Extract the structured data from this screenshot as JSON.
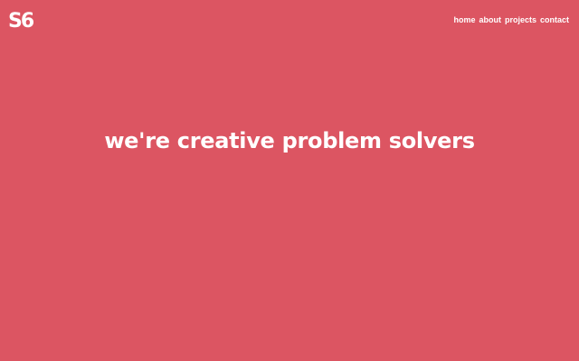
{
  "brand": {
    "logo_text": "S6"
  },
  "nav": {
    "items": [
      {
        "label": "home"
      },
      {
        "label": "about"
      },
      {
        "label": "projects"
      },
      {
        "label": "contact"
      }
    ]
  },
  "hero": {
    "headline": "we're creative problem solvers"
  },
  "colors": {
    "background": "#dc5562",
    "text": "#ffffff"
  }
}
